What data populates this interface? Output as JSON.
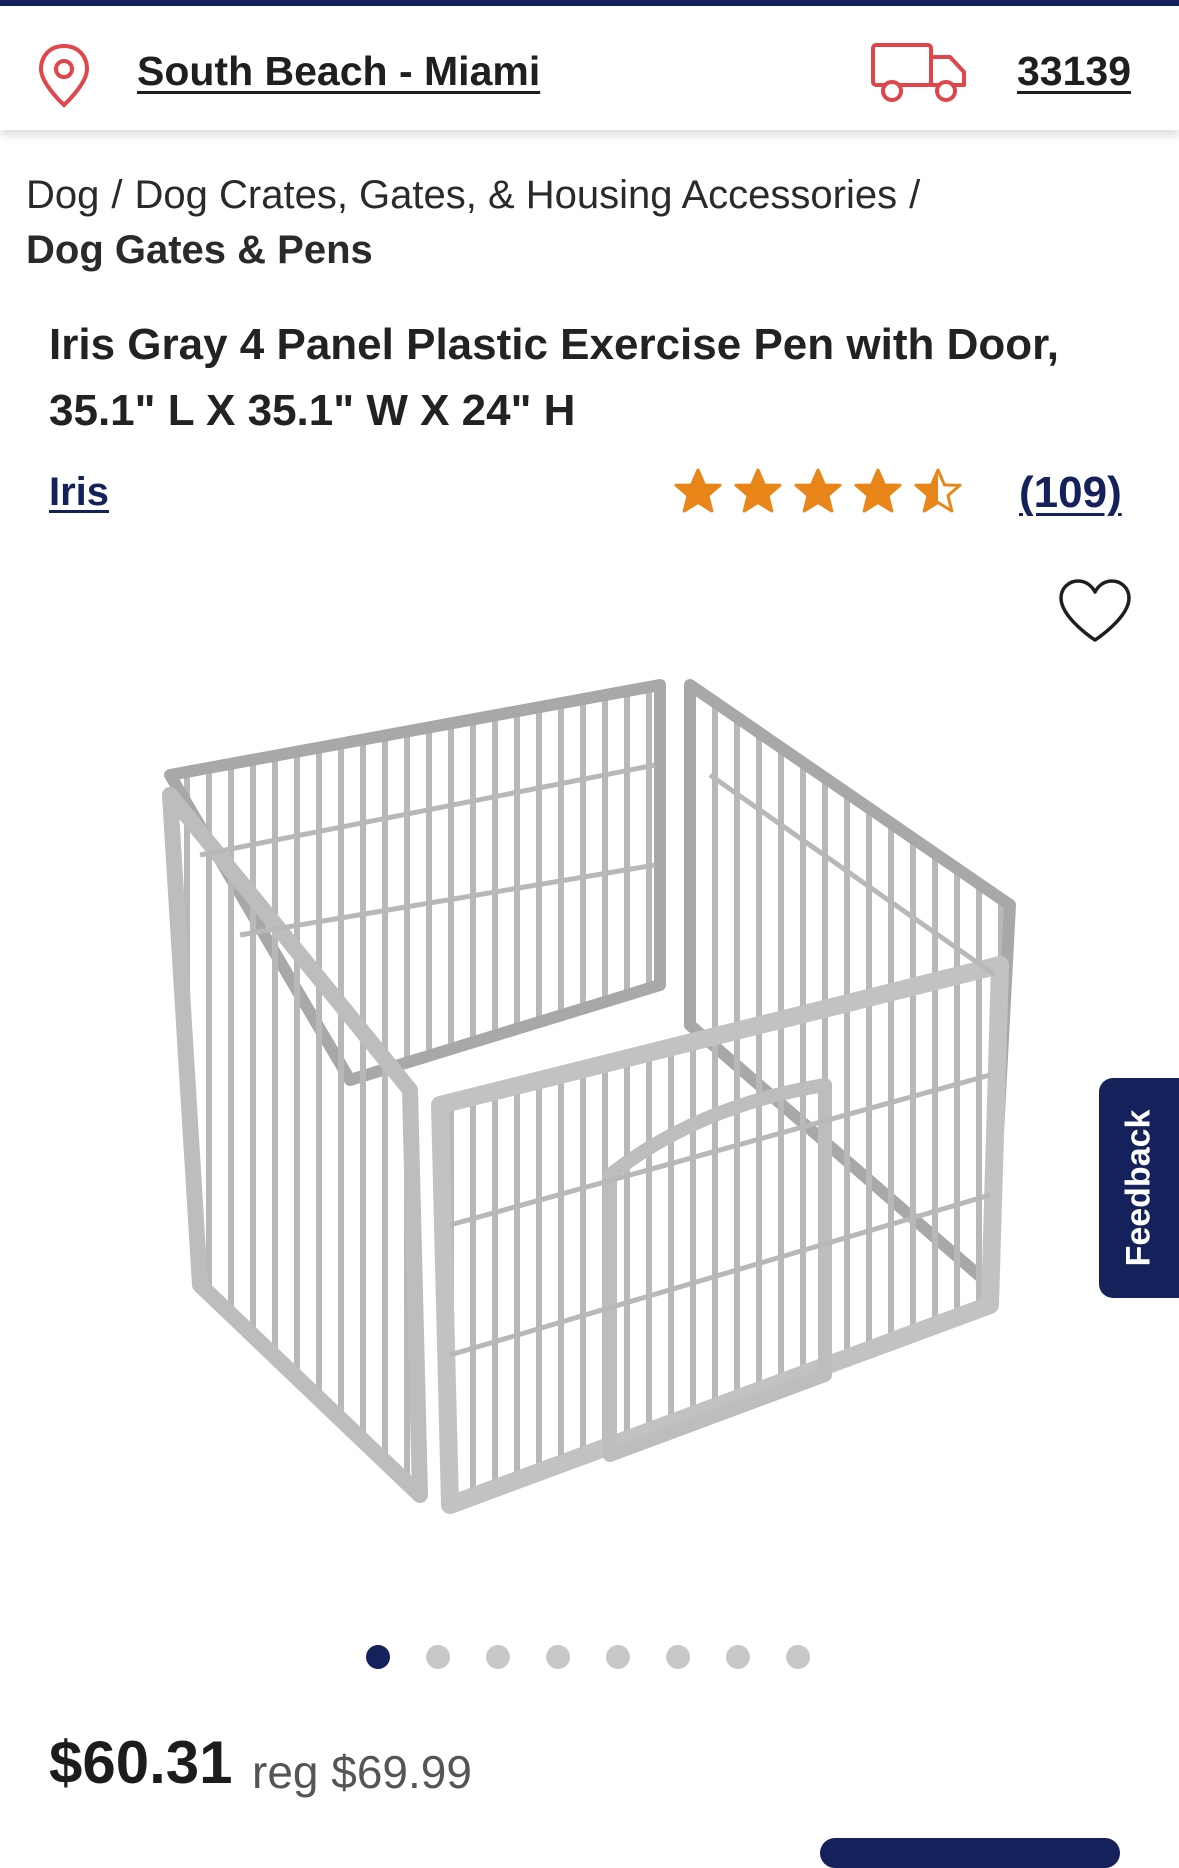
{
  "header": {
    "location": "South Beach - Miami",
    "zip": "33139",
    "icons": [
      "location-pin-icon",
      "delivery-truck-icon"
    ],
    "accent_color": "#e0454a"
  },
  "breadcrumb": {
    "items": [
      "Dog",
      "Dog Crates, Gates, & Housing Accessories"
    ],
    "separator": "/",
    "current": "Dog Gates & Pens"
  },
  "product": {
    "title": "Iris Gray 4 Panel Plastic Exercise Pen with Door, 35.1\" L X 35.1\" W X 24\" H",
    "brand": "Iris",
    "rating": 4.5,
    "rating_max": 5,
    "review_count": "(109)",
    "star_color": "#e8861a",
    "image_icon": "exercise-pen-image",
    "price": "$60.31",
    "reg_price": "reg $69.99"
  },
  "carousel": {
    "total": 8,
    "active_index": 0
  },
  "feedback": {
    "label": "Feedback",
    "color": "#14215a"
  }
}
